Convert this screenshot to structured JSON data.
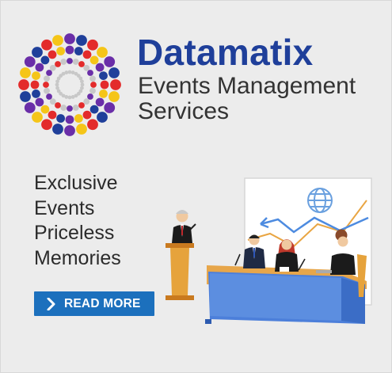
{
  "brand": {
    "name": "Datamatix",
    "tagline_line1": "Events Management",
    "tagline_line2": "Services",
    "color": "#1f3f9a"
  },
  "slogan": {
    "line1": "Exclusive",
    "line2": "Events",
    "line3": "Priceless",
    "line4": "Memories"
  },
  "cta": {
    "label": "READ MORE",
    "icon": "chevron-right-icon",
    "color": "#1c70bd"
  },
  "illustration": {
    "icon": "conference-panel-illustration",
    "accent_colors": [
      "#e8a33a",
      "#3a6fcf",
      "#8ab3e8"
    ]
  },
  "logo": {
    "icon": "dotted-starburst-logo",
    "colors": [
      "#e32b2b",
      "#f5c518",
      "#6a2ea8",
      "#1f3f9a",
      "#c8c8c8"
    ]
  }
}
